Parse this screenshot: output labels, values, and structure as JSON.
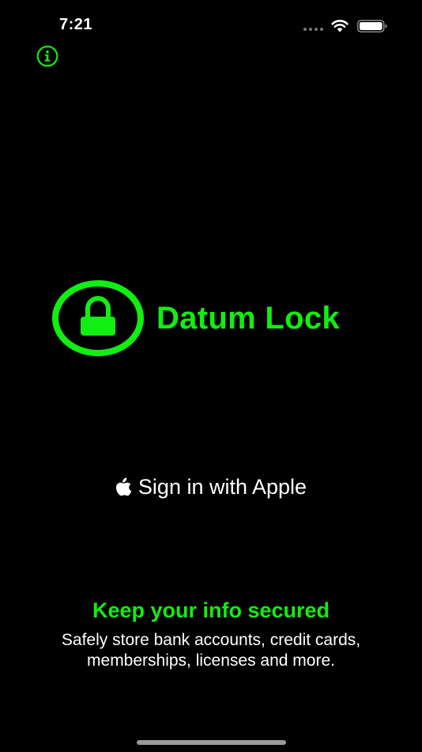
{
  "status_bar": {
    "time": "7:21"
  },
  "header": {
    "info_icon": "info-icon"
  },
  "brand": {
    "icon": "lock-icon",
    "name": "Datum Lock",
    "accent_color": "#11ee11"
  },
  "signin": {
    "icon": "apple-logo-icon",
    "label": "Sign in with Apple"
  },
  "promo": {
    "tagline": "Keep your info secured",
    "description_line1": "Safely store bank accounts, credit cards,",
    "description_line2": "memberships, licenses and more."
  }
}
